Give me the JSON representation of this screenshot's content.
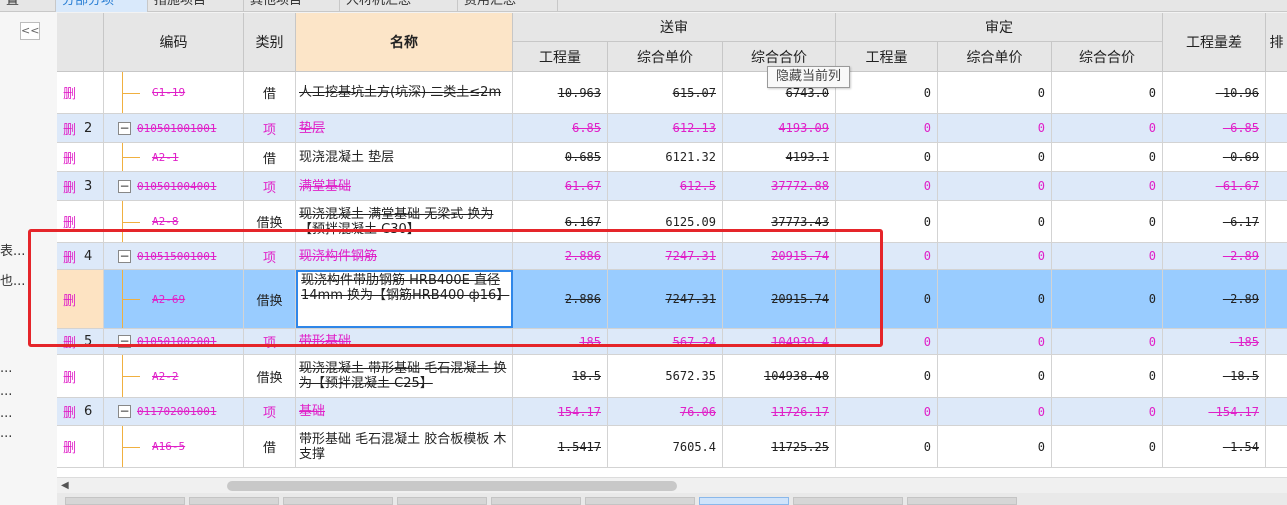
{
  "tabs": [
    "置",
    "分部分项",
    "措施项目",
    "其他项目",
    "人材机汇总",
    "费用汇总"
  ],
  "left_panel": {
    "collapse_label": "<<",
    "items": [
      "表...",
      "也...",
      "...",
      "...",
      "...",
      "..."
    ]
  },
  "headers": {
    "code": "编码",
    "type": "类别",
    "name": "名称",
    "group_submit": "送审",
    "group_audit": "审定",
    "qty": "工程量",
    "unit_price": "综合单价",
    "total_price": "综合合价",
    "diff": "工程量差",
    "extra": "排"
  },
  "tooltip": "隐藏当前列",
  "rows": [
    {
      "del": "删",
      "num": "",
      "code": "G1-19",
      "type": "借",
      "name": "人工挖基坑土方(坑深) 二类土≤2m",
      "q1": "10.963",
      "p1": "615.07",
      "t1": "6743.0",
      "q2": "0",
      "p2": "0",
      "t2": "0",
      "diff": "-10.96"
    },
    {
      "del": "删",
      "num": "2",
      "code": "010501001001",
      "type": "项",
      "name": "垫层",
      "q1": "6.85",
      "p1": "612.13",
      "t1": "4193.09",
      "q2": "0",
      "p2": "0",
      "t2": "0",
      "diff": "-6.85"
    },
    {
      "del": "删",
      "num": "",
      "code": "A2-1",
      "type": "借",
      "name": "现浇混凝土 垫层",
      "q1": "0.685",
      "p1": "6121.32",
      "t1": "4193.1",
      "q2": "0",
      "p2": "0",
      "t2": "0",
      "diff": "-0.69"
    },
    {
      "del": "删",
      "num": "3",
      "code": "010501004001",
      "type": "项",
      "name": "满堂基础",
      "q1": "61.67",
      "p1": "612.5",
      "t1": "37772.88",
      "q2": "0",
      "p2": "0",
      "t2": "0",
      "diff": "-61.67"
    },
    {
      "del": "删",
      "num": "",
      "code": "A2-8",
      "type": "借换",
      "name": "现浇混凝土 满堂基础 无梁式  换为【预拌混凝土 C30】",
      "q1": "6.167",
      "p1": "6125.09",
      "t1": "37773.43",
      "q2": "0",
      "p2": "0",
      "t2": "0",
      "diff": "-6.17"
    },
    {
      "del": "删",
      "num": "4",
      "code": "010515001001",
      "type": "项",
      "name": "现浇构件钢筋",
      "q1": "2.886",
      "p1": "7247.31",
      "t1": "20915.74",
      "q2": "0",
      "p2": "0",
      "t2": "0",
      "diff": "-2.89"
    },
    {
      "del": "删",
      "num": "",
      "code": "A2-69",
      "type": "借换",
      "name": "现浇构件带肋钢筋 HRB400E 直径 14mm  换为【钢筋HRB400 ф16】",
      "q1": "2.886",
      "p1": "7247.31",
      "t1": "20915.74",
      "q2": "0",
      "p2": "0",
      "t2": "0",
      "diff": "-2.89"
    },
    {
      "del": "删",
      "num": "5",
      "code": "010501002001",
      "type": "项",
      "name": "带形基础",
      "q1": "185",
      "p1": "567.24",
      "t1": "104939.4",
      "q2": "0",
      "p2": "0",
      "t2": "0",
      "diff": "-185"
    },
    {
      "del": "删",
      "num": "",
      "code": "A2-2",
      "type": "借换",
      "name": "现浇混凝土 带形基础 毛石混凝土  换为【预拌混凝土 C25】",
      "q1": "18.5",
      "p1": "5672.35",
      "t1": "104938.48",
      "q2": "0",
      "p2": "0",
      "t2": "0",
      "diff": "-18.5"
    },
    {
      "del": "删",
      "num": "6",
      "code": "011702001001",
      "type": "项",
      "name": "基础",
      "q1": "154.17",
      "p1": "76.06",
      "t1": "11726.17",
      "q2": "0",
      "p2": "0",
      "t2": "0",
      "diff": "-154.17"
    },
    {
      "del": "删",
      "num": "",
      "code": "A16-5",
      "type": "借",
      "name": "带形基础 毛石混凝土 胶合板模板 木支撑",
      "q1": "1.5417",
      "p1": "7605.4",
      "t1": "11725.25",
      "q2": "0",
      "p2": "0",
      "t2": "0",
      "diff": "-1.54"
    }
  ],
  "colors": {
    "accent_magenta": "#e020c8",
    "selected_row": "#99ccff",
    "list_row": "#dde9f9",
    "highlight_box": "#e5252a",
    "name_header": "#fce5c8"
  }
}
